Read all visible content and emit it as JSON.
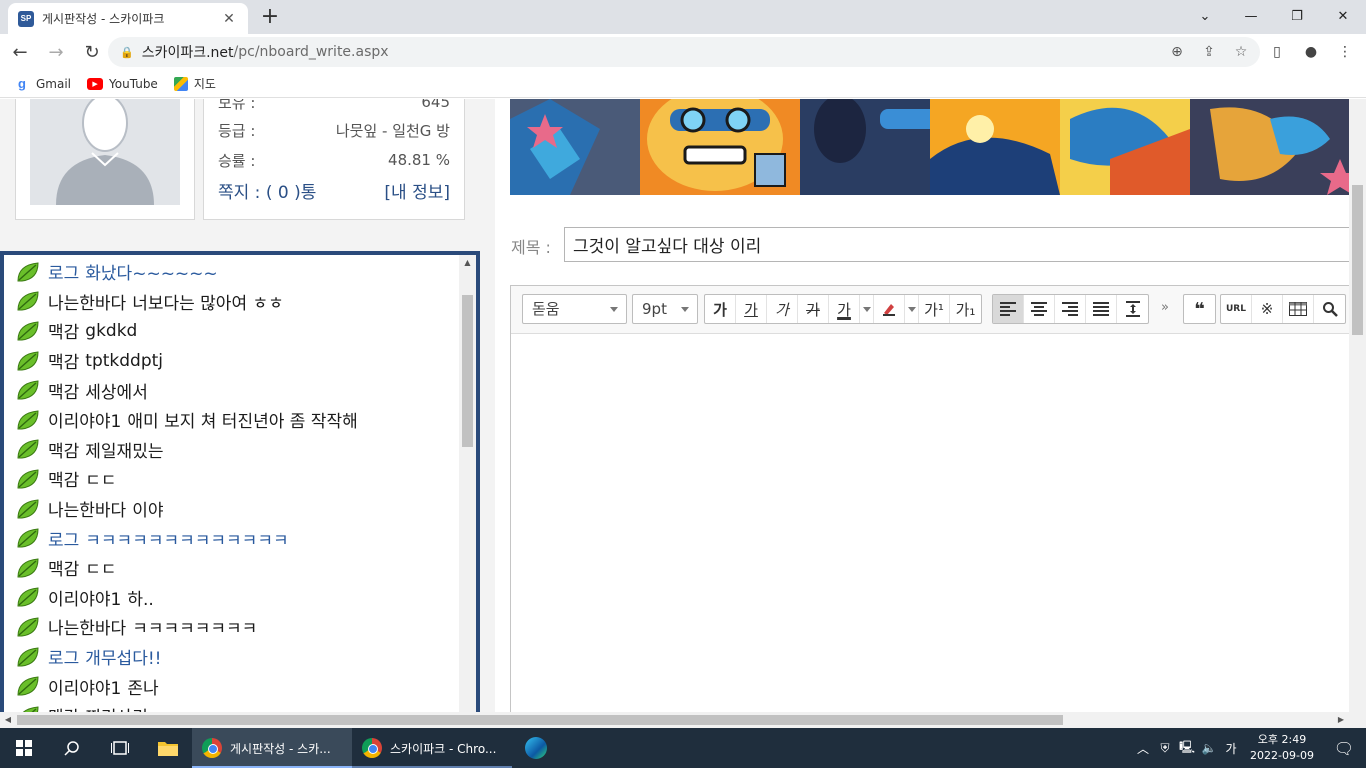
{
  "browser": {
    "tab_title": "게시판작성 - 스카이파크",
    "favicon_text": "SP",
    "url_host": "스카이파크.net",
    "url_path": "/pc/nboard_write.aspx",
    "bookmarks": [
      {
        "label": "Gmail",
        "icon": "g"
      },
      {
        "label": "YouTube",
        "icon": "▶"
      },
      {
        "label": "지도",
        "icon": ""
      }
    ]
  },
  "profile": {
    "rows": [
      {
        "label": "보유 :",
        "value": "645"
      },
      {
        "label": "등급 :",
        "value": "나뭇잎 - 일천G 방"
      },
      {
        "label": "승률 :",
        "value": "48.81 %"
      }
    ],
    "messages_label": "쪽지 : ( 0 )통",
    "my_info_link": "[내 정보]"
  },
  "chat": {
    "items": [
      {
        "name": "로그",
        "msg": "화났다~~~~~~",
        "blue": true
      },
      {
        "name": "나는한바다",
        "msg": "너보다는 많아여 ㅎㅎ",
        "blue": false
      },
      {
        "name": "맥감",
        "msg": "gkdkd",
        "blue": false
      },
      {
        "name": "맥감",
        "msg": "tptkddptj",
        "blue": false
      },
      {
        "name": "맥감",
        "msg": "세상에서",
        "blue": false
      },
      {
        "name": "이리야야1",
        "msg": "애미 보지 쳐 터진년아 좀 작작해",
        "blue": false
      },
      {
        "name": "맥감",
        "msg": "제일재밌는",
        "blue": false
      },
      {
        "name": "맥감",
        "msg": "ㄷㄷ",
        "blue": false
      },
      {
        "name": "나는한바다",
        "msg": "이야",
        "blue": false
      },
      {
        "name": "로그",
        "msg": "ㅋㅋㅋㅋㅋㅋㅋㅋㅋㅋㅋㅋㅋ",
        "blue": true
      },
      {
        "name": "맥감",
        "msg": "ㄷㄷ",
        "blue": false
      },
      {
        "name": "이리야야1",
        "msg": "하..",
        "blue": false
      },
      {
        "name": "나는한바다",
        "msg": "ㅋㅋㅋㅋㅋㅋㅋㅋ",
        "blue": false
      },
      {
        "name": "로그",
        "msg": "개무섭다!!",
        "blue": true
      },
      {
        "name": "이리야야1",
        "msg": "존나",
        "blue": false
      },
      {
        "name": "맥감",
        "msg": "찌리사리",
        "blue": false
      }
    ]
  },
  "write": {
    "subject_label": "제목 :",
    "subject_value": "그것이 알고싶다 대상 이리",
    "font_select": "돋움",
    "size_select": "9pt",
    "format_buttons": [
      "가",
      "가",
      "가",
      "가",
      "가"
    ],
    "superscript": "가¹",
    "subscript": "가₁",
    "quote_glyph": "❝",
    "url_label": "URL"
  },
  "taskbar": {
    "apps": [
      {
        "label": "게시판작성 - 스카...",
        "active": true
      },
      {
        "label": "스카이파크 - Chro...",
        "active": false
      }
    ],
    "ime": "가",
    "time": "오후 2:49",
    "date": "2022-09-09"
  }
}
